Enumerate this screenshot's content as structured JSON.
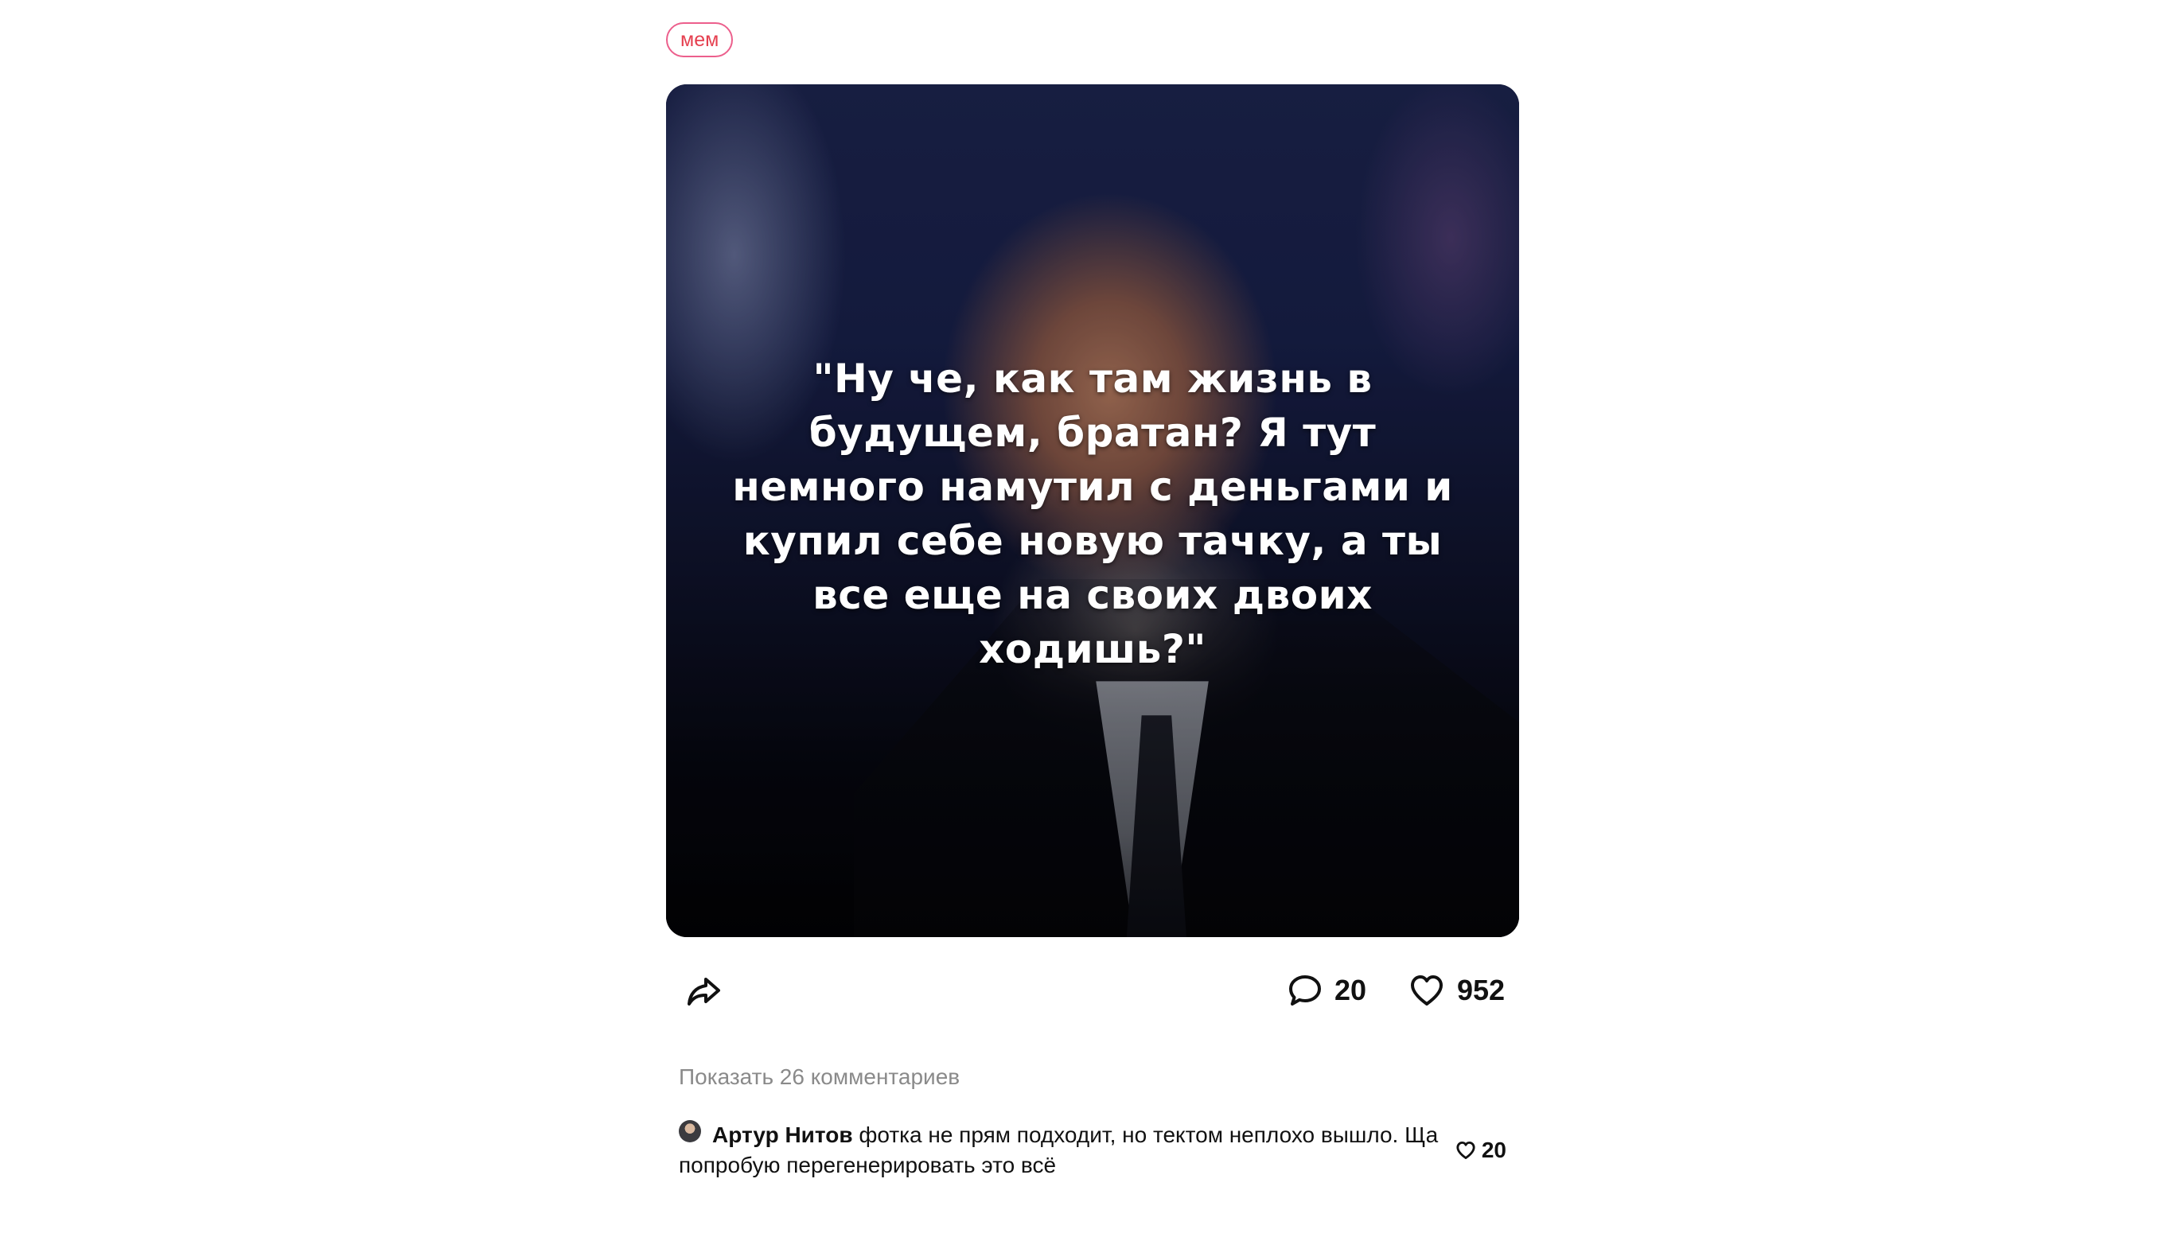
{
  "post": {
    "tag": "мем",
    "image_text": "\"Ну че, как там жизнь в\nбудущем, братан? Я тут\nнемного намутил с деньгами и\nкупил себе новую тачку, а ты\nвсе еще на своих двоих\nходишь?\"",
    "comments_count": "20",
    "likes_count": "952"
  },
  "comments": {
    "show_all_label": "Показать 26 комментариев",
    "items": [
      {
        "author": "Артур Нитов",
        "text": "фотка не прям подходит, но тектом неплохо вышло. Ща попробую перегенерировать это всё",
        "likes": "20"
      }
    ]
  },
  "icons": {
    "share": "share-icon",
    "comment": "comment-icon",
    "heart": "heart-icon"
  },
  "colors": {
    "tag_border": "#ec5f8c",
    "tag_text": "#e53f4f",
    "muted_text": "#8a8a8a"
  }
}
